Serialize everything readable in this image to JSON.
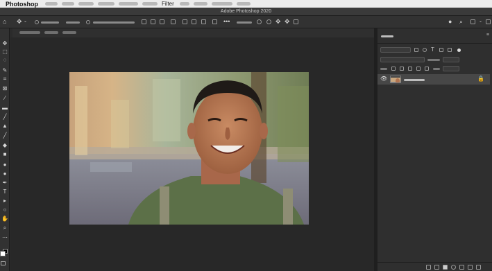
{
  "menubar": {
    "app_name": "Photoshop",
    "filter_label": "Filter"
  },
  "window": {
    "title": "Adobe Photoshop 2020"
  },
  "colors": {
    "accent": "#2b2b2b",
    "panel": "#2f2f2f",
    "menubar": "#ececec"
  },
  "optionsbar": {
    "more_label": "•••"
  },
  "toolbar": {
    "tools": [
      "move-icon",
      "marquee-icon",
      "lasso-icon",
      "quick-select-icon",
      "crop-icon",
      "frame-icon",
      "eyedropper-icon",
      "healing-icon",
      "brush-icon",
      "stamp-icon",
      "history-brush-icon",
      "eraser-icon",
      "gradient-icon",
      "blur-icon",
      "dodge-icon",
      "pen-icon",
      "type-icon",
      "path-select-icon",
      "shape-icon",
      "hand-icon",
      "zoom-icon",
      "more-tools-icon"
    ]
  },
  "layers": {
    "rows": [
      {
        "visible": true,
        "locked": true
      }
    ]
  }
}
